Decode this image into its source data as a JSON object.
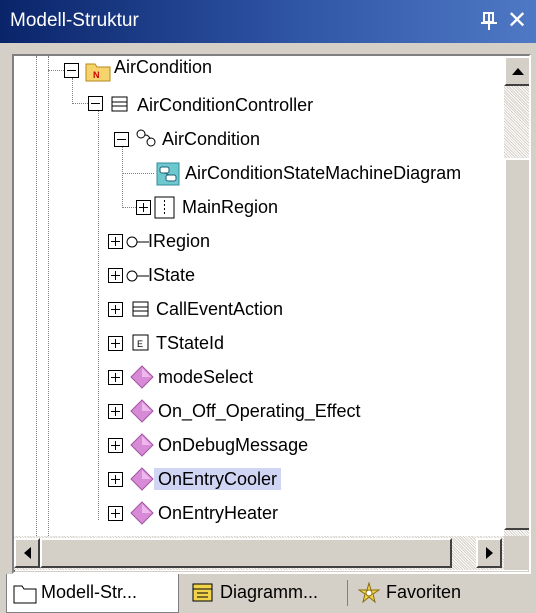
{
  "window": {
    "title": "Modell-Struktur",
    "pin_icon": "pin-icon",
    "close_label": "✕"
  },
  "tree": {
    "items": [
      {
        "label": "AirCondition",
        "icon": "namespace-package-icon",
        "expander": "collapse"
      },
      {
        "label": "AirConditionController",
        "icon": "class-icon",
        "expander": "collapse"
      },
      {
        "label": "AirCondition",
        "icon": "state-machine-icon",
        "expander": "collapse"
      },
      {
        "label": "AirConditionStateMachineDiagram",
        "icon": "state-machine-diagram-icon",
        "expander": "none"
      },
      {
        "label": "MainRegion",
        "icon": "region-icon",
        "expander": "expand"
      },
      {
        "label": "IRegion",
        "icon": "interface-icon",
        "expander": "expand"
      },
      {
        "label": "IState",
        "icon": "interface-icon",
        "expander": "expand"
      },
      {
        "label": "CallEventAction",
        "icon": "class-icon",
        "expander": "expand"
      },
      {
        "label": "TStateId",
        "icon": "enumeration-icon",
        "expander": "expand"
      },
      {
        "label": "modeSelect",
        "icon": "operation-icon",
        "expander": "expand"
      },
      {
        "label": "On_Off_Operating_Effect",
        "icon": "operation-icon",
        "expander": "expand"
      },
      {
        "label": "OnDebugMessage",
        "icon": "operation-icon",
        "expander": "expand"
      },
      {
        "label": "OnEntryCooler",
        "icon": "operation-icon",
        "expander": "expand",
        "selected": true
      },
      {
        "label": "OnEntryHeater",
        "icon": "operation-icon",
        "expander": "expand"
      }
    ]
  },
  "tabs": [
    {
      "label": "Modell-Str...",
      "icon": "folder-icon",
      "active": true
    },
    {
      "label": "Diagramm...",
      "icon": "diagram-tree-icon",
      "active": false
    },
    {
      "label": "Favoriten",
      "icon": "favorites-icon",
      "active": false
    }
  ],
  "colors": {
    "title_bar": "#0a246a",
    "selection": "#cfd5f2",
    "operation_icon": "#d78ad6"
  }
}
